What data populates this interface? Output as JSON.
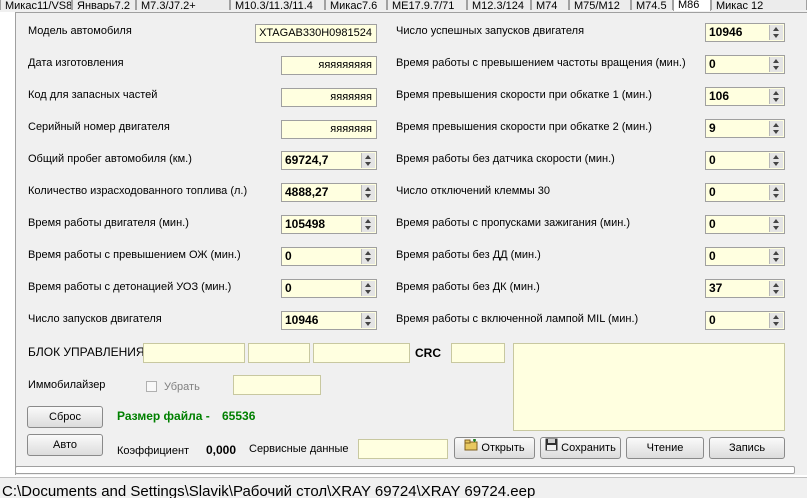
{
  "tabs": [
    "Микас11/VS8",
    "Январь7.2",
    "M7.3/J7.2+",
    "M10.3/11.3/11.4",
    "Микас7.6",
    "ME17.9.7/71",
    "M12.3/124",
    "M74",
    "M75/M12",
    "M74.5",
    "M86",
    "Микас 12"
  ],
  "left_fields": [
    {
      "label": "Модель автомобиля",
      "value": "XTAGAB330H0981524",
      "kind": "text"
    },
    {
      "label": "Дата изготовления",
      "value": "яяяяяяяяя",
      "kind": "text"
    },
    {
      "label": "Код для запасных частей",
      "value": "яяяяяяя",
      "kind": "text"
    },
    {
      "label": "Серийный номер двигателя",
      "value": "яяяяяяя",
      "kind": "text"
    },
    {
      "label": "Общий пробег автомобиля  (км.)",
      "value": "69724,7",
      "kind": "spin"
    },
    {
      "label": "Количество израсходованного топлива (л.)",
      "value": "4888,27",
      "kind": "spin"
    },
    {
      "label": "Время работы двигателя (мин.)",
      "value": "105498",
      "kind": "spin"
    },
    {
      "label": "Время работы с превышением ОЖ (мин.)",
      "value": "0",
      "kind": "spin"
    },
    {
      "label": "Время работы с детонацией УОЗ (мин.)",
      "value": "0",
      "kind": "spin"
    },
    {
      "label": "Число запусков двигателя",
      "value": "10946",
      "kind": "spin"
    }
  ],
  "right_fields": [
    {
      "label": "Число успешных запусков двигателя",
      "value": "10946"
    },
    {
      "label": "Время работы с превышением частоты вращения (мин.)",
      "value": "0"
    },
    {
      "label": "Время превышения скорости при обкатке 1 (мин.)",
      "value": "106"
    },
    {
      "label": "Время превышения скорости при обкатке 2 (мин.)",
      "value": "9"
    },
    {
      "label": "Время работы без датчика скорости (мин.)",
      "value": "0"
    },
    {
      "label": "Число отключений клеммы 30",
      "value": "0"
    },
    {
      "label": "Время работы с пропусками зажигания (мин.)",
      "value": "0"
    },
    {
      "label": "Время работы без ДД (мин.)",
      "value": "0"
    },
    {
      "label": "Время работы без ДК (мин.)",
      "value": "37"
    },
    {
      "label": "Время работы с включенной лампой MIL (мин.)",
      "value": "0"
    }
  ],
  "ecu": {
    "label": "БЛОК УПРАВЛЕНИЯ",
    "crc_label": "CRC"
  },
  "immo": {
    "label": "Иммобилайзер",
    "checkbox_label": "Убрать"
  },
  "buttons": {
    "reset": "Сброс",
    "auto": "Авто",
    "open": "Открыть",
    "save": "Сохранить",
    "read": "Чтение",
    "write": "Запись"
  },
  "file_size": {
    "label": "Размер файла  -",
    "value": "65536"
  },
  "coef": {
    "label": "Коэффициент",
    "value": "0,000"
  },
  "service": {
    "label": "Сервисные данные"
  },
  "status": {
    "path": "C:\\Documents and Settings\\Slavik\\Рабочий стол\\XRAY 69724\\XRAY 69724.eep"
  },
  "colors": {
    "field_bg": "#ffffe0",
    "panel_bg": "#f0f0f0",
    "file_size_text": "#008000"
  }
}
